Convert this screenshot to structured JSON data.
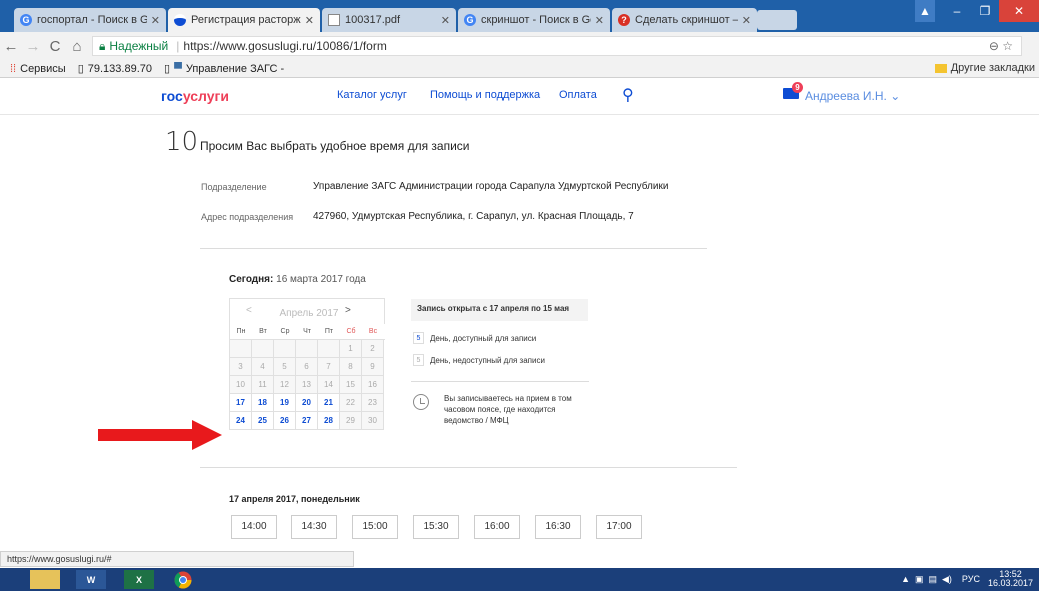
{
  "browser": {
    "tabs": [
      {
        "title": "госпортал - Поиск в Go",
        "color": "#4285f4",
        "icon": "google-icon"
      },
      {
        "title": "Регистрация расторжен",
        "color": "#0d4cd3",
        "icon": "gosuslugi-flag-icon"
      },
      {
        "title": "100317.pdf",
        "color": "#888888",
        "icon": "document-icon"
      },
      {
        "title": "скриншот - Поиск в Go",
        "color": "#4285f4",
        "icon": "google-icon"
      },
      {
        "title": "Сделать скриншот — О",
        "color": "#d93025",
        "icon": "page-icon"
      }
    ],
    "url_secure_label": "Надежный",
    "url": "https://www.gosuslugi.ru/10086/1/form",
    "bookmarks": [
      "Сервисы",
      "79.133.89.70",
      "Управление ЗАГС - "
    ],
    "bookmarks_other": "Другие закладки",
    "status_url": "https://www.gosuslugi.ru/#"
  },
  "site": {
    "logo_part1": "гос",
    "logo_part2": "услуги",
    "nav": [
      "Каталог услуг",
      "Помощь и поддержка",
      "Оплата"
    ],
    "mail_count": "9",
    "user": "Андреева И.Н."
  },
  "form": {
    "step_number": "10",
    "step_title": "Просим Вас выбрать удобное время для записи",
    "department_label": "Подразделение",
    "department_value": "Управление ЗАГС Администрации города Сарапула Удмуртской Республики",
    "address_label": "Адрес подразделения",
    "address_value": "427960, Удмуртская Республика, г. Сарапул, ул. Красная Площадь, 7",
    "today_label": "Сегодня:",
    "today_value": "16 марта 2017 года",
    "calendar": {
      "month": "Апрель 2017",
      "weekdays": [
        "Пн",
        "Вт",
        "Ср",
        "Чт",
        "Пт",
        "Сб",
        "Вс"
      ],
      "weeks": [
        [
          "",
          "",
          "",
          "",
          "",
          "1",
          "2"
        ],
        [
          "3",
          "4",
          "5",
          "6",
          "7",
          "8",
          "9"
        ],
        [
          "10",
          "11",
          "12",
          "13",
          "14",
          "15",
          "16"
        ],
        [
          "17",
          "18",
          "19",
          "20",
          "21",
          "22",
          "23"
        ],
        [
          "24",
          "25",
          "26",
          "27",
          "28",
          "29",
          "30"
        ]
      ],
      "available_days": [
        "17",
        "18",
        "19",
        "20",
        "21",
        "24",
        "25",
        "26",
        "27",
        "28"
      ]
    },
    "legend_title": "Запись открыта с 17 апреля по 15 мая",
    "legend_available_num": "5",
    "legend_available": "День, доступный для записи",
    "legend_unavailable_num": "5",
    "legend_unavailable": "День, недоступный для записи",
    "tz_note": "Вы записываетесь на прием в том часовом поясе, где находится ведомство / МФЦ",
    "selected_date": "17 апреля 2017, понедельник",
    "time_slots": [
      "14:00",
      "14:30",
      "15:00",
      "15:30",
      "16:00",
      "16:30",
      "17:00"
    ]
  },
  "taskbar": {
    "lang": "РУС",
    "time": "13:52",
    "date": "16.03.2017"
  },
  "colors": {
    "brand_blue": "#0d4cd3",
    "brand_red": "#ee3f58",
    "arrow_red": "#e8191c"
  }
}
